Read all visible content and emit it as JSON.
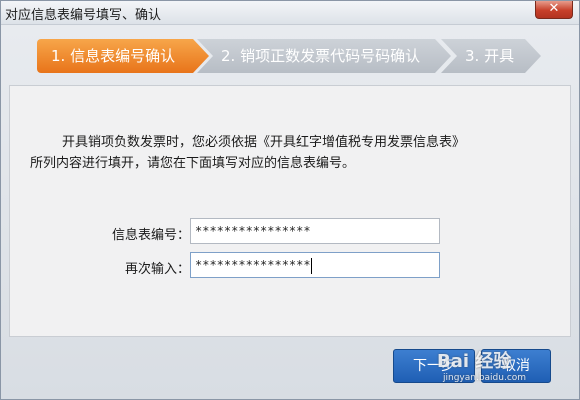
{
  "window": {
    "title": "对应信息表编号填写、确认",
    "close_glyph": "✕"
  },
  "steps": [
    {
      "label": "1. 信息表编号确认",
      "active": true,
      "color": "#f08a2a"
    },
    {
      "label": "2. 销项正数发票代码号码确认",
      "active": false,
      "color": "#c2c7ce"
    },
    {
      "label": "3. 开具",
      "active": false,
      "color": "#c2c7ce"
    }
  ],
  "notice": {
    "line1": "开具销项负数发票时，您必须依据《开具红字增值税专用发票信息表》",
    "line2": "所列内容进行填开，请您在下面填写对应的信息表编号。"
  },
  "form": {
    "info_number_label": "信息表编号：",
    "info_number_value": "****************",
    "confirm_label": "再次输入：",
    "confirm_value": "****************"
  },
  "buttons": {
    "next": "下一步",
    "cancel": "取消"
  },
  "watermark": {
    "text": "Bai 经验",
    "sub": "jingyan.baidu.com"
  }
}
